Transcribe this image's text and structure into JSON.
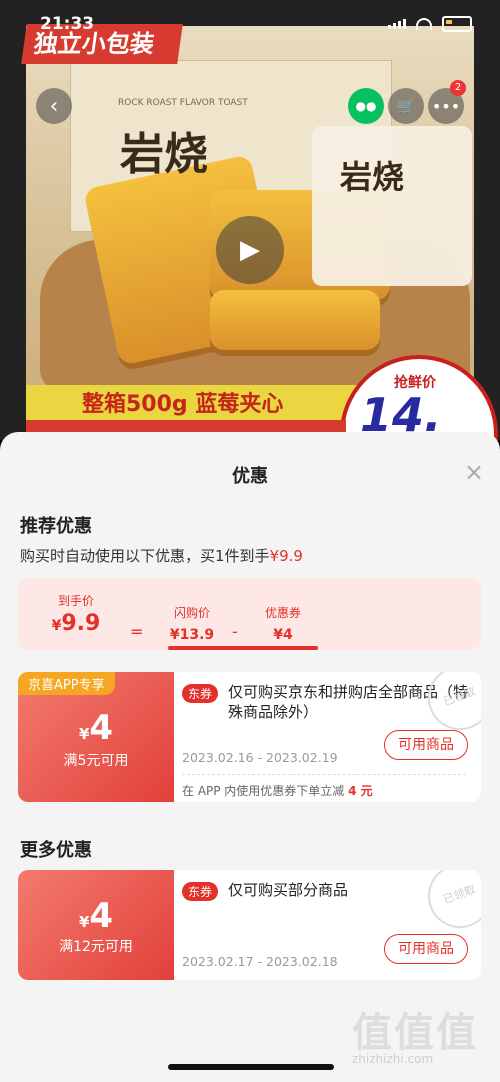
{
  "status_bar": {
    "time": "21:33"
  },
  "hero": {
    "banner_text": "独立小包装",
    "brand_big": "岩烧",
    "brand_tag": "ROCK ROAST FLAVOR TOAST",
    "pack_label": "岩烧",
    "strip_text": "整箱500g 蓝莓夹心",
    "price_badge_label": "抢鲜价",
    "price_badge_value": "14.",
    "cart_badge": "2"
  },
  "sheet": {
    "title": "优惠",
    "recommended_title": "推荐优惠",
    "desc_prefix": "购买时自动使用以下优惠，买1件到手",
    "desc_price": "¥9.9",
    "summary": {
      "final_label": "到手价",
      "final_yen": "¥",
      "final_value": "9.9",
      "eq": "=",
      "flash_label": "闪购价",
      "flash_value": "¥13.9",
      "minus": "-",
      "coupon_label": "优惠券",
      "coupon_value": "¥4"
    },
    "coupons": [
      {
        "tag": "京喜APP专享",
        "yen": "¥",
        "amount": "4",
        "condition": "满5元可用",
        "type": "东券",
        "text": "仅可购买京东和拼购店全部商品（特殊商品除外）",
        "date": "2023.02.16 - 2023.02.19",
        "button": "可用商品",
        "note_prefix": "在 APP 内使用优惠券下单立减",
        "note_amount": "4 元",
        "stamp": "已领取"
      },
      {
        "yen": "¥",
        "amount": "4",
        "condition": "满12元可用",
        "type": "东券",
        "text": "仅可购买部分商品",
        "date": "2023.02.17 - 2023.02.18",
        "button": "可用商品",
        "stamp": "已领取"
      }
    ],
    "more_title": "更多优惠"
  },
  "watermark": {
    "big": "值值值",
    "small": "zhizhizhi.com"
  }
}
